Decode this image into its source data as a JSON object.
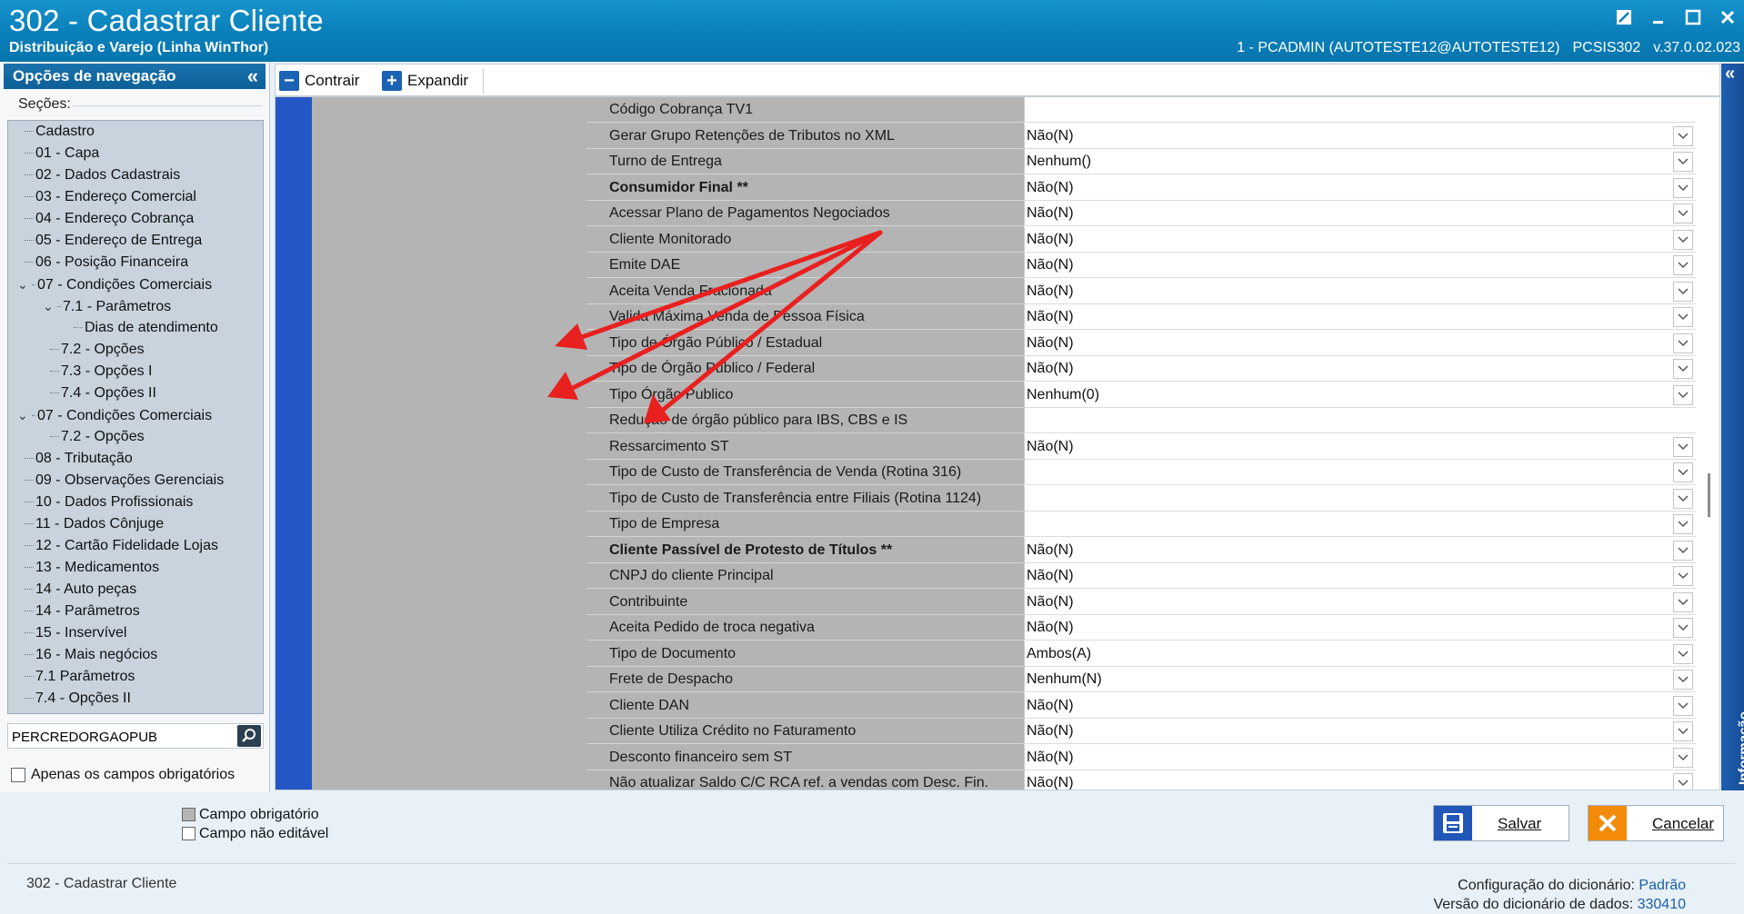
{
  "window": {
    "title": "302 - Cadastrar Cliente",
    "subtitle": "Distribuição e Varejo (Linha WinThor)",
    "session": "1 - PCADMIN (AUTOTESTE12@AUTOTESTE12)",
    "routine": "PCSIS302",
    "version": "v.37.0.02.023"
  },
  "nav": {
    "header": "Opções de navegação",
    "sections_label": "Seções:",
    "items": [
      {
        "label": "Cadastro"
      },
      {
        "label": "01 - Capa"
      },
      {
        "label": "02 - Dados Cadastrais"
      },
      {
        "label": "03 - Endereço Comercial"
      },
      {
        "label": "04 - Endereço Cobrança"
      },
      {
        "label": "05 - Endereço de Entrega"
      },
      {
        "label": "06 - Posição Financeira"
      },
      {
        "label": "07 - Condições Comerciais"
      },
      {
        "label": "7.1 - Parâmetros"
      },
      {
        "label": "Dias de atendimento"
      },
      {
        "label": "7.2 - Opções"
      },
      {
        "label": "7.3 - Opções I"
      },
      {
        "label": "7.4 - Opções II"
      },
      {
        "label": "07 - Condições Comerciais"
      },
      {
        "label": "7.2 - Opções"
      },
      {
        "label": "08 - Tributação"
      },
      {
        "label": "09 - Observações Gerenciais"
      },
      {
        "label": "10 - Dados Profissionais"
      },
      {
        "label": "11 - Dados Cônjuge"
      },
      {
        "label": "12 - Cartão Fidelidade Lojas"
      },
      {
        "label": "13 - Medicamentos"
      },
      {
        "label": "14 - Auto peças"
      },
      {
        "label": "14 - Parâmetros"
      },
      {
        "label": "15 - Inservível"
      },
      {
        "label": "16 - Mais negócios"
      },
      {
        "label": "7.1 Parâmetros"
      },
      {
        "label": "7.4 - Opções II"
      }
    ],
    "search_value": "PERCREDORGAOPUB",
    "only_required_label": "Apenas os campos obrigatórios"
  },
  "toolbar": {
    "collapse_label": "Contrair",
    "expand_label": "Expandir"
  },
  "grid": {
    "rows": [
      {
        "label": "Código Cobrança TV1",
        "value": ""
      },
      {
        "label": "Gerar Grupo Retenções de Tributos  no XML",
        "value": "Não(N)"
      },
      {
        "label": "Turno de Entrega",
        "value": "Nenhum()"
      },
      {
        "label": "Consumidor Final **",
        "value": "Não(N)"
      },
      {
        "label": "Acessar Plano de Pagamentos Negociados",
        "value": "Não(N)"
      },
      {
        "label": "Cliente Monitorado",
        "value": "Não(N)"
      },
      {
        "label": "Emite DAE",
        "value": "Não(N)"
      },
      {
        "label": "Aceita Venda Fracionada",
        "value": "Não(N)"
      },
      {
        "label": "Valida Máxima Venda de Pessoa Física",
        "value": "Não(N)"
      },
      {
        "label": "Tipo de Órgão Público / Estadual",
        "value": "Não(N)"
      },
      {
        "label": "Tipo de Órgão Público / Federal",
        "value": "Não(N)"
      },
      {
        "label": "Tipo Órgão Publico",
        "value": "Nenhum(0)"
      },
      {
        "label": "Redução de órgão público para IBS, CBS e IS",
        "value": ""
      },
      {
        "label": "Ressarcimento ST",
        "value": "Não(N)"
      },
      {
        "label": "Tipo de Custo de Transferência de Venda (Rotina 316)",
        "value": ""
      },
      {
        "label": "Tipo de Custo de Transferência entre Filiais (Rotina 1124)",
        "value": ""
      },
      {
        "label": "Tipo de Empresa",
        "value": ""
      },
      {
        "label": "Cliente Passível de Protesto de Títulos **",
        "value": "Não(N)"
      },
      {
        "label": "CNPJ do cliente Principal",
        "value": "Não(N)"
      },
      {
        "label": "Contribuinte",
        "value": "Não(N)"
      },
      {
        "label": "Aceita Pedido de troca negativa",
        "value": "Não(N)"
      },
      {
        "label": "Tipo de Documento",
        "value": "Ambos(A)"
      },
      {
        "label": "Frete de Despacho",
        "value": "Nenhum(N)"
      },
      {
        "label": "Cliente DAN",
        "value": "Não(N)"
      },
      {
        "label": "Cliente Utiliza Crédito no Faturamento",
        "value": "Não(N)"
      },
      {
        "label": "Desconto financeiro sem ST",
        "value": "Não(N)"
      },
      {
        "label": "Não atualizar Saldo C/C RCA ref. a vendas com Desc. Fin.",
        "value": "Não(N)"
      }
    ]
  },
  "side_panel": {
    "label": "Informação"
  },
  "legend": {
    "required": "Campo obrigatório",
    "not_editable": "Campo não editável"
  },
  "actions": {
    "save_label": "Salvar",
    "cancel_label": "Cancelar"
  },
  "status": {
    "left": "302 - Cadastrar Cliente",
    "dict_config_label": "Configuração do dicionário:",
    "dict_config_value": "Padrão",
    "dict_version_label": "Versão do dicionário de dados:",
    "dict_version_value": "330410"
  },
  "colors": {
    "titlebar": "#0a7fba",
    "nav_header": "#1b73ad",
    "row_indicator": "#2457c5",
    "label_column": "#b4b4b4",
    "annotation_arrow": "#e8201f"
  }
}
